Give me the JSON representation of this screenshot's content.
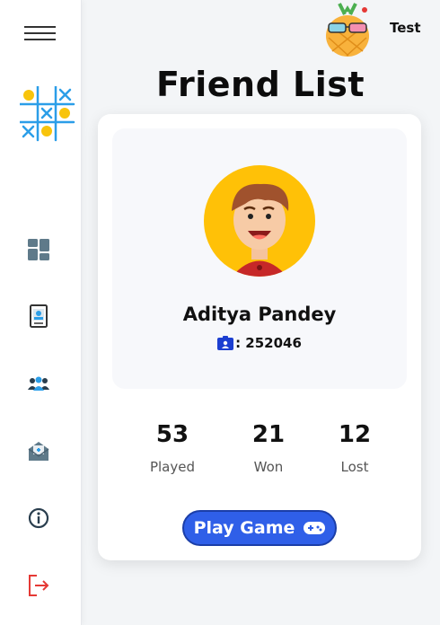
{
  "header": {
    "username": "Test"
  },
  "page": {
    "title": "Friend List"
  },
  "friend": {
    "name": "Aditya Pandey",
    "id_text": ": 252046"
  },
  "stats": [
    {
      "value": "53",
      "label": "Played"
    },
    {
      "value": "21",
      "label": "Won"
    },
    {
      "value": "12",
      "label": "Lost"
    }
  ],
  "actions": {
    "play_label": "Play Game"
  },
  "sidebar": {
    "icons": [
      "menu-icon",
      "dashboard-icon",
      "profile-card-icon",
      "friends-icon",
      "inbox-icon",
      "info-icon",
      "logout-icon"
    ]
  },
  "colors": {
    "accent": "#2f5fe8",
    "logout": "#e53935",
    "logo_yellow": "#f8c40c",
    "logo_blue": "#2b9ee8"
  }
}
